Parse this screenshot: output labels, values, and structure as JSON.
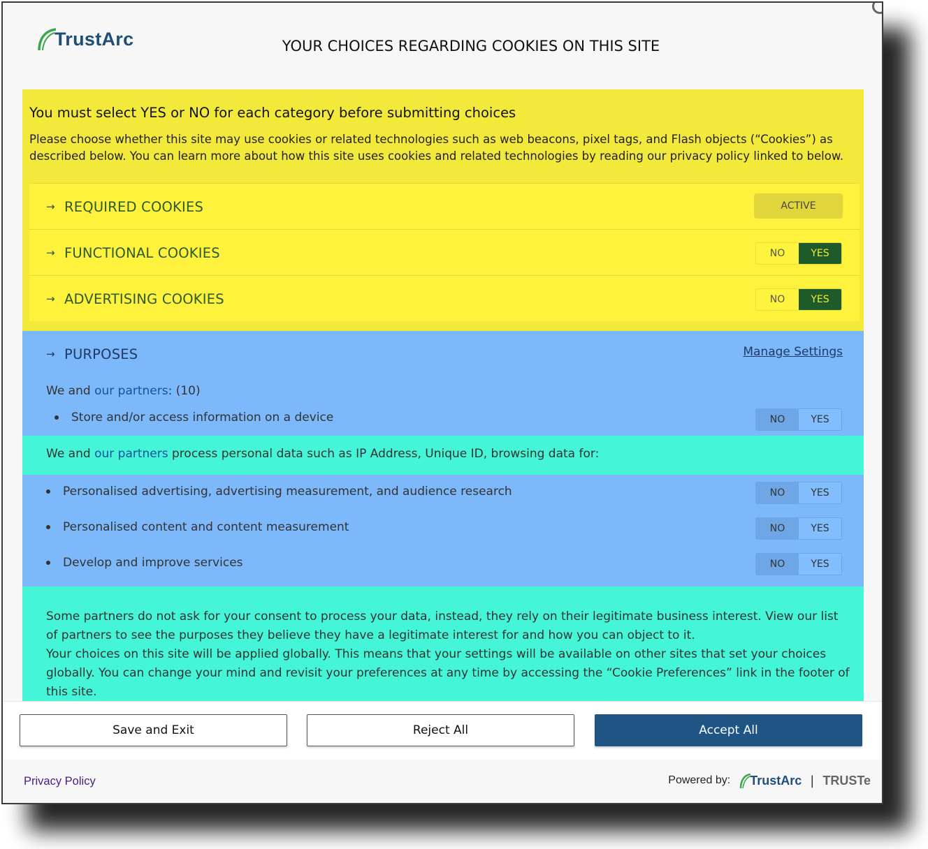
{
  "header": {
    "logo_text": "TrustArc",
    "title": "YOUR CHOICES REGARDING COOKIES ON THIS SITE"
  },
  "intro": {
    "heading": "You must select YES or NO for each category before submitting choices",
    "description": "Please choose whether this site may use cookies or related technologies such as web beacons, pixel tags, and Flash objects (“Cookies”) as described below. You can learn more about how this site uses cookies and related technologies by reading our privacy policy linked to below."
  },
  "categories": [
    {
      "label": "REQUIRED COOKIES",
      "status": "ACTIVE"
    },
    {
      "label": "FUNCTIONAL COOKIES",
      "no": "NO",
      "yes": "YES",
      "selected": "YES"
    },
    {
      "label": "ADVERTISING COOKIES",
      "no": "NO",
      "yes": "YES",
      "selected": "YES"
    }
  ],
  "arrow_glyph": "→",
  "purposes": {
    "label": "PURPOSES",
    "manage_settings": "Manage Settings",
    "we_and": "We and",
    "our_partners": "our partners",
    "count": ": (10)",
    "store_item": "Store and/or access information on a device",
    "process_prefix": "We and",
    "process_link_our": "our",
    "process_link_partners": "partners",
    "process_suffix": "process personal data such as IP Address, Unique ID, browsing data for:",
    "items": [
      "Personalised advertising, advertising measurement, and audience research",
      "Personalised content and content measurement",
      "Develop and improve services"
    ],
    "no": "NO",
    "yes": "YES"
  },
  "legitimate": {
    "line1": "Some partners do not ask for your consent to process your data, instead, they rely on their legitimate business interest. View our list of partners to see the purposes they believe they have a legitimate interest for and how you can object to it.",
    "line2": "Your choices on this site will be applied globally. This means that your settings will be available on other sites that set your choices globally. You can change your mind and revisit your preferences at any time by accessing the “Cookie Preferences” link in the footer of this site."
  },
  "buttons": {
    "save": "Save and Exit",
    "reject": "Reject All",
    "accept": "Accept All"
  },
  "footer": {
    "privacy": "Privacy Policy",
    "powered_by": "Powered by:",
    "brand": "TrustArc",
    "separator": "|",
    "truste": "TRUSTe"
  },
  "colors": {
    "yellow": "#f3e93a",
    "blue": "#7db8fb",
    "cyan": "#44f5d8",
    "accept": "#1f5485",
    "yes_on": "#1f5a2a"
  }
}
